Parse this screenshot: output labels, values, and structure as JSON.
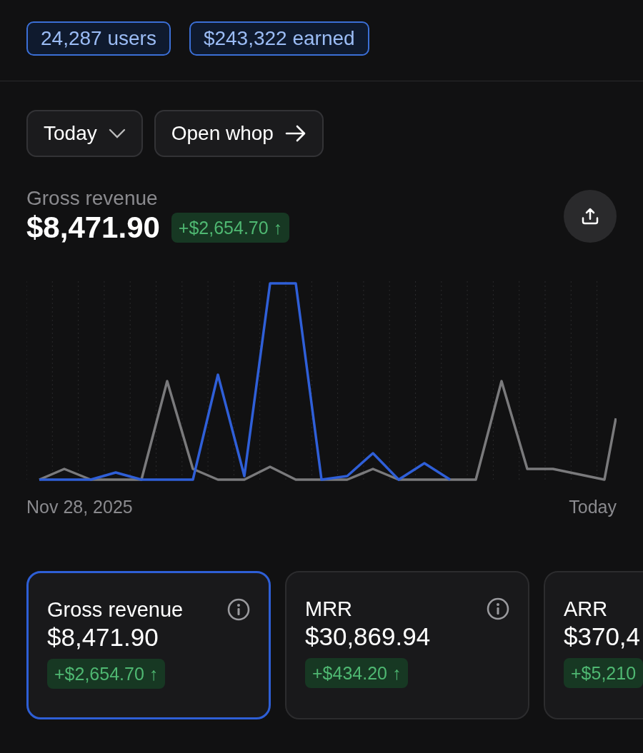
{
  "stats": [
    "24,287 users",
    "$243,322 earned"
  ],
  "buttons": [
    {
      "label": "Today",
      "kind": "dropdown"
    },
    {
      "label": "Open whop",
      "kind": "link"
    }
  ],
  "headline": {
    "label": "Gross revenue",
    "value": "$8,471.90",
    "change": "+$2,654.70 ↑"
  },
  "chart": {
    "start_label": "Nov 28, 2025",
    "end_label": "Today"
  },
  "cards": [
    {
      "title": "Gross revenue",
      "value": "$8,471.90",
      "change": "+$2,654.70 ↑",
      "selected": true,
      "info": true
    },
    {
      "title": "MRR",
      "value": "$30,869.94",
      "change": "+$434.20 ↑",
      "selected": false,
      "info": true
    },
    {
      "title": "ARR",
      "value": "$370,4",
      "change": "+$5,210",
      "selected": false,
      "info": false
    }
  ]
}
